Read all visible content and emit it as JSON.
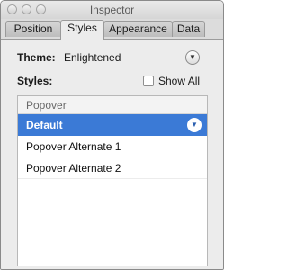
{
  "window": {
    "title": "Inspector"
  },
  "tabs": [
    {
      "label": "Position",
      "active": false
    },
    {
      "label": "Styles",
      "active": true
    },
    {
      "label": "Appearance",
      "active": false
    },
    {
      "label": "Data",
      "active": false
    }
  ],
  "theme": {
    "label": "Theme:",
    "value": "Enlightened"
  },
  "styles": {
    "label": "Styles:",
    "show_all_label": "Show All",
    "show_all_checked": false
  },
  "list": {
    "header": "Popover",
    "items": [
      {
        "label": "Default",
        "selected": true
      },
      {
        "label": "Popover Alternate 1",
        "selected": false
      },
      {
        "label": "Popover Alternate 2",
        "selected": false
      }
    ]
  },
  "icons": {
    "dropdown": "chevron-down-icon",
    "selected_row_dropdown": "chevron-down-icon"
  },
  "colors": {
    "selection": "#3b7ad6",
    "window_bg": "#ececec"
  }
}
